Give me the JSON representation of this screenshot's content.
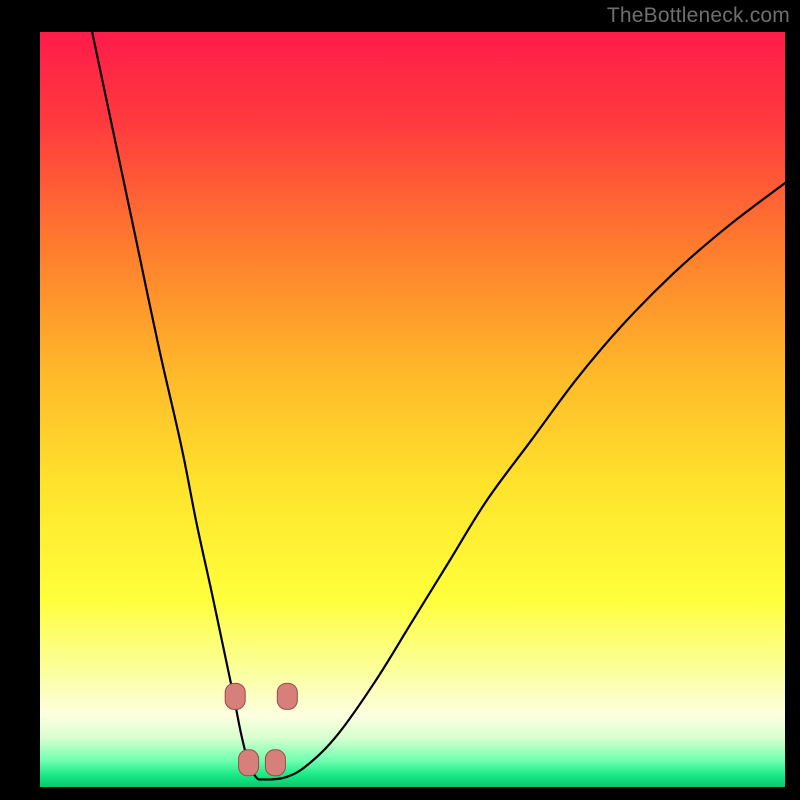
{
  "watermark": "TheBottleneck.com",
  "colors": {
    "frame": "#000000",
    "curve": "#000000",
    "marker_fill": "#d77f7b",
    "marker_stroke": "#9b4a46",
    "gradient_stops": [
      {
        "offset": 0.0,
        "color": "#ff1b4a"
      },
      {
        "offset": 0.12,
        "color": "#ff3a3e"
      },
      {
        "offset": 0.28,
        "color": "#ff7a2e"
      },
      {
        "offset": 0.45,
        "color": "#ffb82a"
      },
      {
        "offset": 0.6,
        "color": "#ffe32c"
      },
      {
        "offset": 0.75,
        "color": "#ffff3a"
      },
      {
        "offset": 0.85,
        "color": "#fbffa0"
      },
      {
        "offset": 0.905,
        "color": "#fdffe0"
      },
      {
        "offset": 0.935,
        "color": "#d8ffd0"
      },
      {
        "offset": 0.965,
        "color": "#6fffb0"
      },
      {
        "offset": 0.985,
        "color": "#17e884"
      },
      {
        "offset": 1.0,
        "color": "#08c86c"
      }
    ]
  },
  "chart_data": {
    "type": "line",
    "title": "",
    "xlabel": "",
    "ylabel": "",
    "xlim": [
      0,
      100
    ],
    "ylim": [
      0,
      100
    ],
    "grid": false,
    "legend": false,
    "series": [
      {
        "name": "curve",
        "x": [
          7,
          10,
          13,
          16,
          19,
          21,
          23,
          24.5,
          26,
          27,
          28,
          29,
          30,
          33,
          36,
          40,
          45,
          50,
          55,
          60,
          66,
          72,
          78,
          85,
          92,
          100
        ],
        "y": [
          100,
          86,
          72,
          58,
          45,
          35,
          26,
          19,
          12,
          7,
          3.2,
          1.3,
          1.0,
          1.3,
          3.0,
          7,
          14,
          22,
          30,
          38,
          46,
          54,
          61,
          68,
          74,
          80
        ]
      }
    ],
    "markers": [
      {
        "x": 26.2,
        "y": 12.0
      },
      {
        "x": 33.2,
        "y": 12.0
      },
      {
        "x": 28.0,
        "y": 3.2
      },
      {
        "x": 31.6,
        "y": 3.2
      }
    ],
    "valley_x": 29.5
  }
}
